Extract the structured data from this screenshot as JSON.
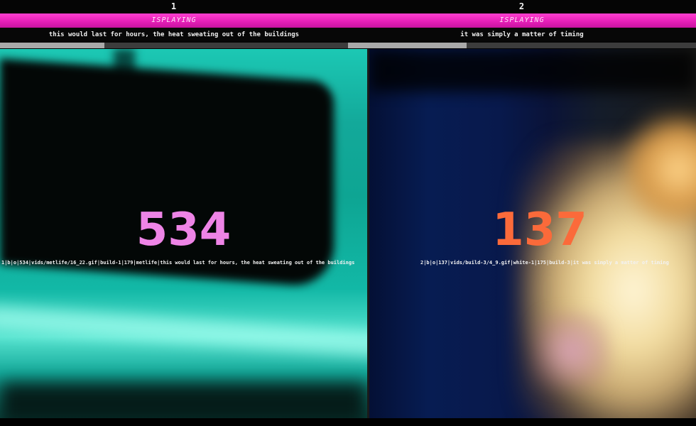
{
  "columns": [
    {
      "number": "1",
      "status": "ISPLAYING",
      "caption": "this would last for hours, the heat sweating out of the buildings",
      "progress": 0.3,
      "counter": "534",
      "counter_color": "#ee84e6",
      "meta": "1|b|o|534|vids/metlife/16_22.gif|build-1|179|metlife|this would last for hours, the heat sweating out of the buildings"
    },
    {
      "number": "2",
      "status": "ISPLAYING",
      "caption": "it was simply a matter of timing",
      "progress": 0.34,
      "counter": "137",
      "counter_color": "#fb6a3a",
      "meta": "2|b|o|137|vids/build-3/4_9.gif|white-1|175|build-3|it was simply a matter of timing"
    }
  ],
  "colors": {
    "status_bar": "#e61fb8",
    "progress_fill": "#a9a9a9",
    "progress_track": "#3c3c3c"
  }
}
